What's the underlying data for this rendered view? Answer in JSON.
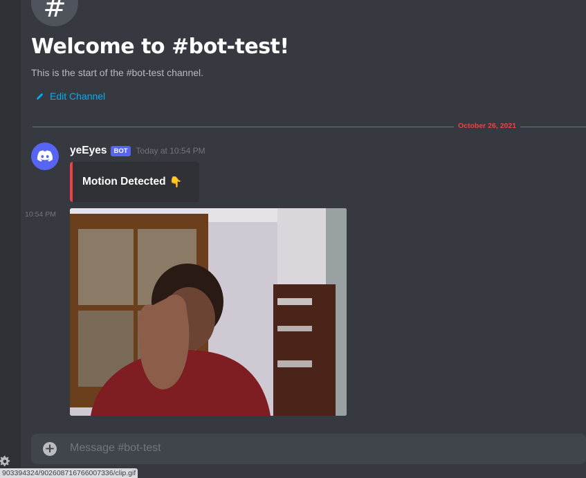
{
  "channel": {
    "hash_symbol": "#",
    "welcome_title": "Welcome to #bot-test!",
    "start_text": "This is the start of the #bot-test channel.",
    "edit_label": "Edit Channel"
  },
  "date_divider": "October 26, 2021",
  "message": {
    "author": "yeEyes",
    "bot_tag": "BOT",
    "timestamp": "Today at 10:54 PM",
    "embed_title": "Motion Detected",
    "embed_emoji": "👇",
    "side_timestamp": "10:54 PM",
    "attachment_icon": "webcam-gif-image"
  },
  "composer": {
    "placeholder": "Message #bot-test"
  },
  "status_url": "903394324/902608716766007336/clip.gif",
  "colors": {
    "accent": "#5865f2",
    "link": "#00b0f4",
    "divider_red": "#ed4245",
    "background": "#36393f"
  }
}
